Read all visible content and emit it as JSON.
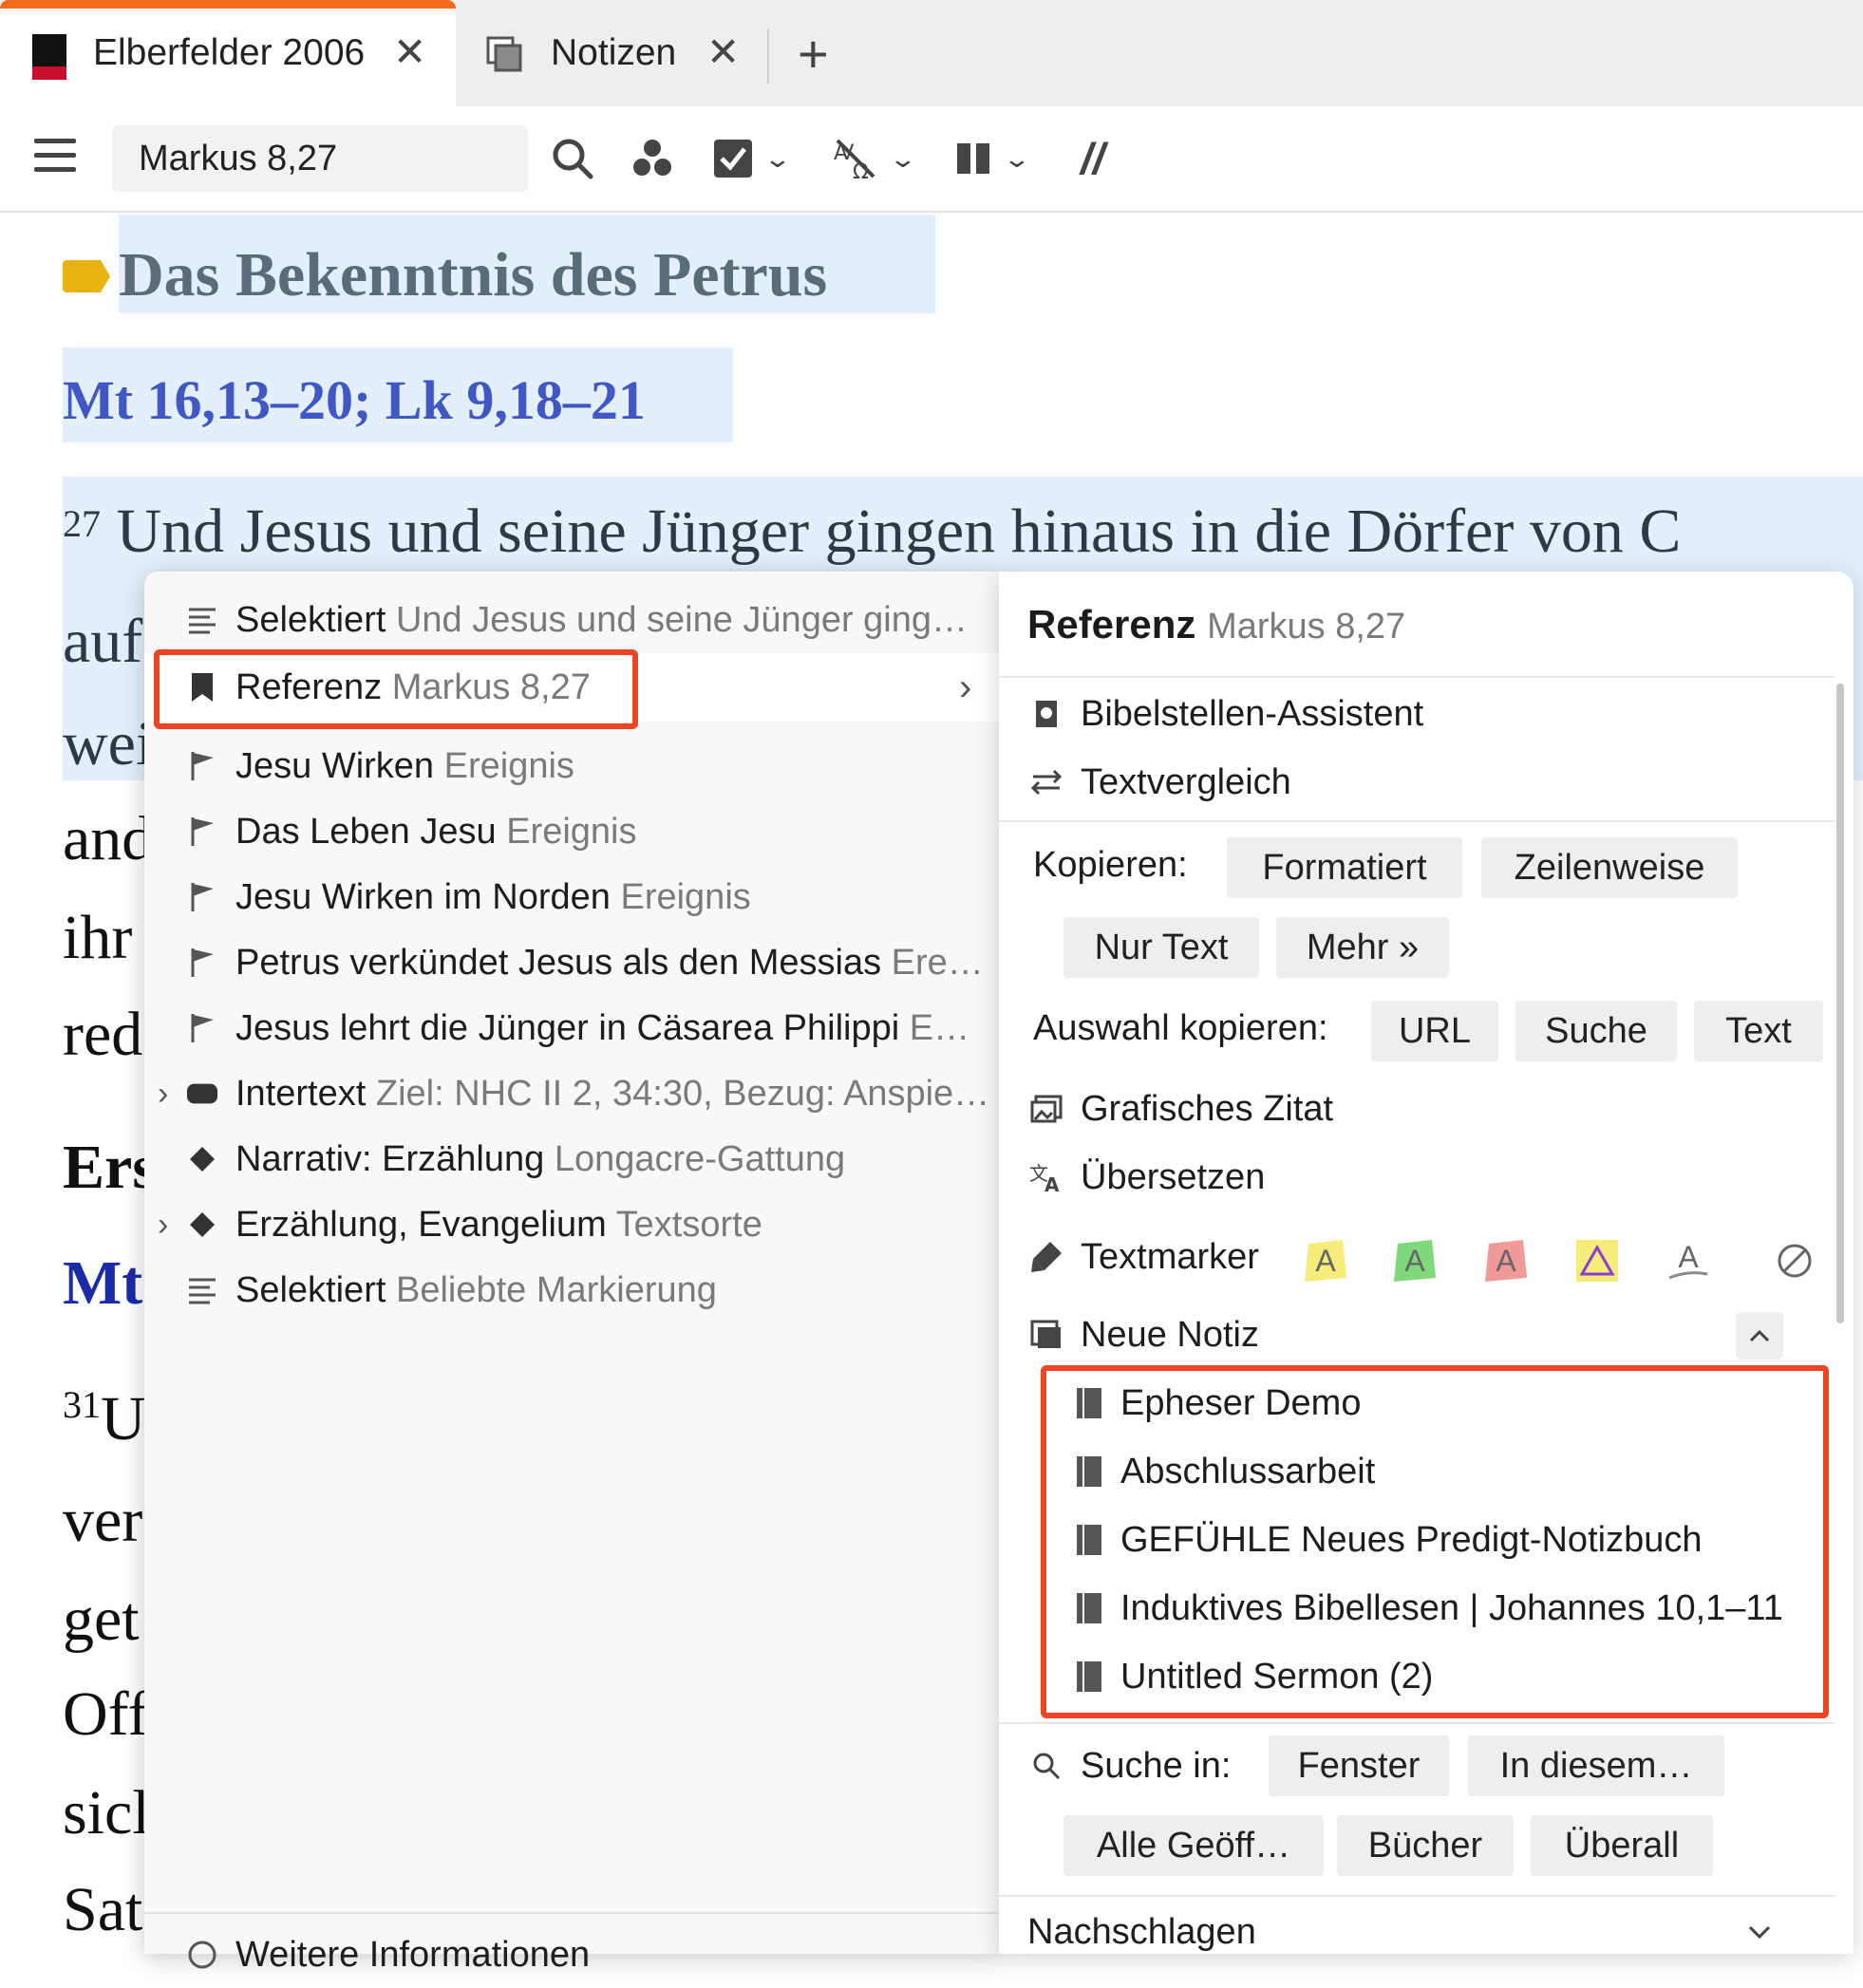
{
  "tabs": [
    {
      "label": "Elberfelder 2006",
      "close": "✕"
    },
    {
      "label": "Notizen",
      "close": "✕"
    }
  ],
  "toolbar": {
    "reference_value": "Markus 8,27",
    "parallel_label": "//"
  },
  "bible": {
    "heading": "Das Bekenntnis des Petrus",
    "parallels": "Mt 16,13–20; Lk 9,18–21",
    "verse27_num": "27",
    "verse27_text": "Und Jesus und seine Jünger gingen hinaus in die Dörfer von C",
    "line_fragments": [
      "auf",
      "wei",
      "and",
      "ihr",
      "red",
      "Ers",
      "Mt",
      "ver",
      "get",
      "Off",
      "sicl",
      "Sat"
    ],
    "verse31_num": "31",
    "verse31_start": "U"
  },
  "context_menu": {
    "left_items": [
      {
        "icon": "lines-icon",
        "label": "Selektiert",
        "sub": "Und Jesus und seine Jünger ging…"
      },
      {
        "icon": "bookmark-icon",
        "label": "Referenz",
        "sub": "Markus 8,27",
        "arrow": "›"
      },
      {
        "icon": "flag-icon",
        "label": "Jesu Wirken",
        "sub": "Ereignis"
      },
      {
        "icon": "flag-icon",
        "label": "Das Leben Jesu",
        "sub": "Ereignis"
      },
      {
        "icon": "flag-icon",
        "label": "Jesu Wirken im Norden",
        "sub": "Ereignis"
      },
      {
        "icon": "flag-icon",
        "label": "Petrus verkündet Jesus als den Messias",
        "sub": "Ere…"
      },
      {
        "icon": "flag-icon",
        "label": "Jesus lehrt die Jünger in Cäsarea Philippi",
        "sub": "E…"
      },
      {
        "icon": "pill-icon",
        "label": "Intertext",
        "sub": "Ziel: NHC II 2, 34:30, Bezug: Anspie…",
        "expander": "›"
      },
      {
        "icon": "diamond-icon",
        "label": "Narrativ: Erzählung",
        "sub": "Longacre-Gattung"
      },
      {
        "icon": "diamond-icon",
        "label": "Erzählung, Evangelium",
        "sub": "Textsorte",
        "expander": "›"
      },
      {
        "icon": "lines-icon",
        "label": "Selektiert",
        "sub": "Beliebte Markierung"
      }
    ],
    "footer": "Weitere Informationen"
  },
  "submenu": {
    "title": "Referenz",
    "title_sub": "Markus 8,27",
    "bibelstellen": "Bibelstellen-Assistent",
    "textvergleich": "Textvergleich",
    "kopieren_label": "Kopieren:",
    "kopieren_buttons": [
      "Formatiert",
      "Zeilenweise",
      "Nur Text",
      "Mehr »"
    ],
    "auswahl_label": "Auswahl kopieren:",
    "auswahl_buttons": [
      "URL",
      "Suche",
      "Text"
    ],
    "grafisches_zitat": "Grafisches Zitat",
    "uebersetzen": "Übersetzen",
    "textmarker": "Textmarker",
    "highlighter_letter": "A",
    "highlight_colors": [
      "#f5ec7a",
      "#7fd87a",
      "#f29a9a",
      "#f5ec7a"
    ],
    "neue_notiz": "Neue Notiz",
    "notebooks": [
      "Epheser Demo",
      "Abschlussarbeit",
      "GEFÜHLE Neues Predigt-Notizbuch",
      "Induktives Bibellesen | Johannes 10,1–11",
      "Untitled Sermon (2)"
    ],
    "suche_label": "Suche in:",
    "suche_buttons": [
      "Fenster",
      "In diesem…",
      "Alle Geöff…",
      "Bücher",
      "Überall"
    ],
    "nachschlagen": "Nachschlagen"
  },
  "colors": {
    "accent_orange": "#f26a1b",
    "highlight_blue": "#e3f0fb",
    "red_box": "#ee4423",
    "parallel_blue": "#4157c4",
    "tag_yellow": "#e8b213"
  }
}
